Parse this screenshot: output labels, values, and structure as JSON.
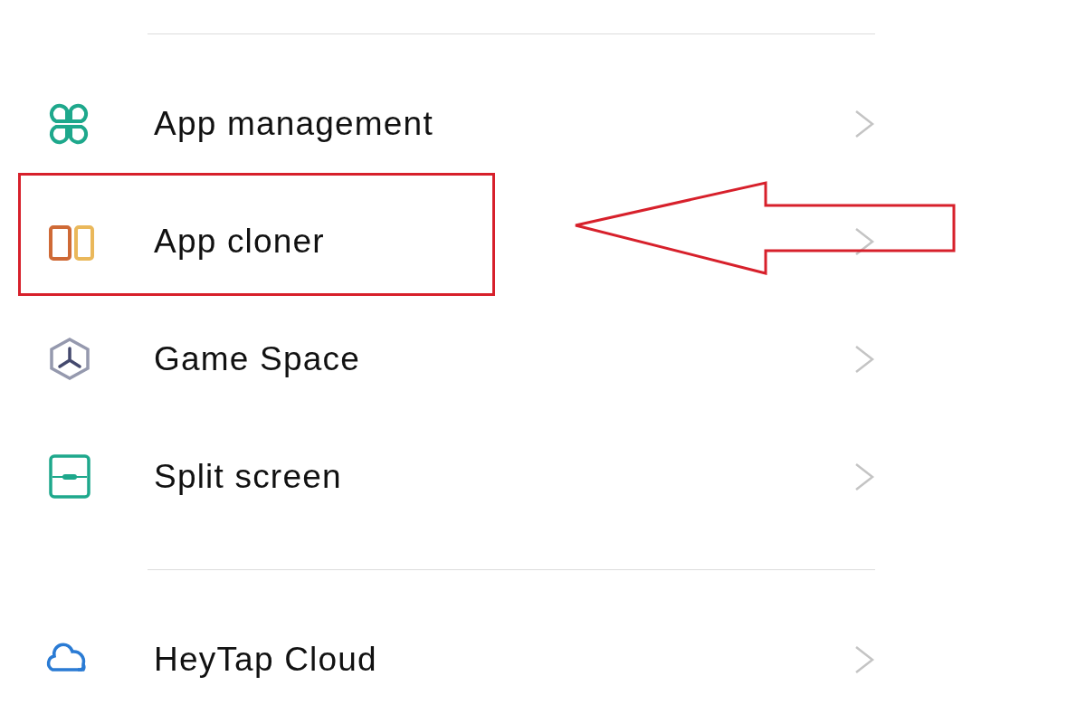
{
  "groups": [
    {
      "items": [
        {
          "label": "App management",
          "annotated": false
        },
        {
          "label": "App cloner",
          "annotated": true
        },
        {
          "label": "Game Space",
          "annotated": false
        },
        {
          "label": "Split screen",
          "annotated": false
        }
      ]
    },
    {
      "items": [
        {
          "label": "HeyTap Cloud",
          "annotated": false
        }
      ]
    }
  ]
}
